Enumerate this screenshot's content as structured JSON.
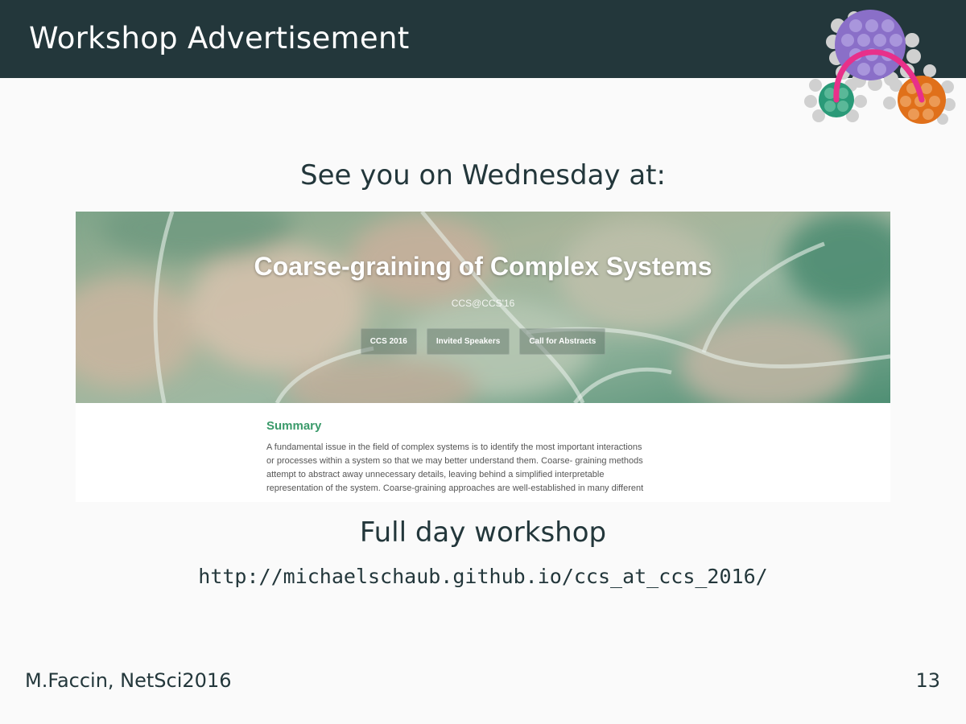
{
  "slide": {
    "title": "Workshop Advertisement",
    "intro": "See you on Wednesday at:",
    "caption": "Full day workshop",
    "url": "http://michaelschaub.github.io/ccs_at_ccs_2016/",
    "footer_left": "M.Faccin, NetSci2016",
    "page_number": "13"
  },
  "website": {
    "title": "Coarse-graining of Complex Systems",
    "subtitle": "CCS@CCS'16",
    "nav": [
      "CCS 2016",
      "Invited Speakers",
      "Call for Abstracts"
    ],
    "summary_heading": "Summary",
    "summary_lines": [
      "A fundamental issue in the field of complex systems is to identify the most important interactions",
      "or processes within a system so that we may better understand them. Coarse- graining methods",
      "attempt to abstract away unnecessary details, leaving behind a simplified interpretable",
      "representation of the system. Coarse-graining approaches are well-established in many different"
    ]
  },
  "colors": {
    "header_bg": "#23373b",
    "text": "#23373b",
    "summary_heading": "#3a9a6a",
    "logo_purple": "#8a6fc8",
    "logo_green": "#2a9a78",
    "logo_orange": "#e0701a",
    "logo_arc": "#e8308a"
  },
  "icons": [
    "network-logo-icon"
  ]
}
